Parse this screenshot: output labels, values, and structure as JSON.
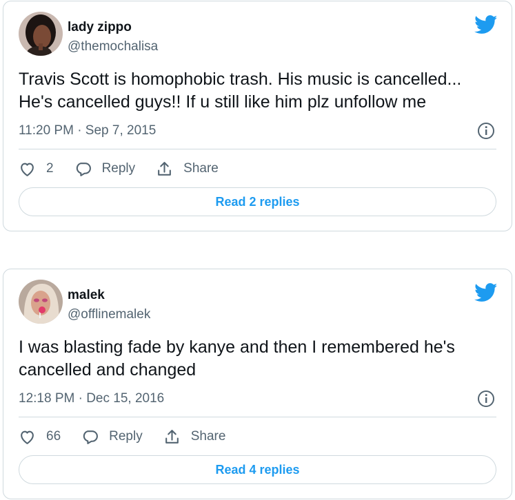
{
  "colors": {
    "accent": "#1d9bf0",
    "text": "#0f1419",
    "secondary": "#536471",
    "border": "#cfd9de"
  },
  "tweets": [
    {
      "name": "lady zippo",
      "handle": "@themochalisa",
      "text": "Travis Scott is homophobic trash. His music is cancelled... He's cancelled guys!! If u still like him plz unfollow me",
      "timestamp": "11:20 PM · Sep 7, 2015",
      "like_count": "2",
      "reply_label": "Reply",
      "share_label": "Share",
      "read_replies_label": "Read 2 replies"
    },
    {
      "name": "malek",
      "handle": "@offlinemalek",
      "text": "I was blasting fade by kanye and then I remembered he's cancelled and changed",
      "timestamp": "12:18 PM · Dec 15, 2016",
      "like_count": "66",
      "reply_label": "Reply",
      "share_label": "Share",
      "read_replies_label": "Read 4 replies"
    }
  ],
  "icons": {
    "brand": "twitter-bird-icon",
    "info": "info-icon",
    "like": "heart-icon",
    "reply": "speech-bubble-icon",
    "share": "share-upload-icon"
  }
}
